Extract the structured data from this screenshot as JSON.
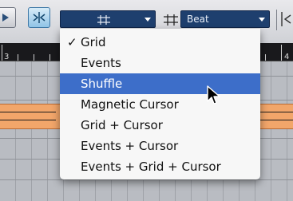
{
  "toolbar": {
    "snap_type_combo": "",
    "quantize_combo": "Beat"
  },
  "ruler": {
    "left_num": "3",
    "right_num": "4"
  },
  "snap_menu": {
    "items": [
      {
        "label": "Grid",
        "checked": true
      },
      {
        "label": "Events"
      },
      {
        "label": "Shuffle",
        "highlighted": true
      },
      {
        "label": "Magnetic Cursor"
      },
      {
        "label": "Grid + Cursor"
      },
      {
        "label": "Events + Cursor"
      },
      {
        "label": "Events + Grid + Cursor"
      }
    ],
    "checkmark": "✓"
  },
  "colors": {
    "highlight": "#3d6ec9",
    "event": "#f2a66a",
    "combo": "#1e3f6e"
  }
}
